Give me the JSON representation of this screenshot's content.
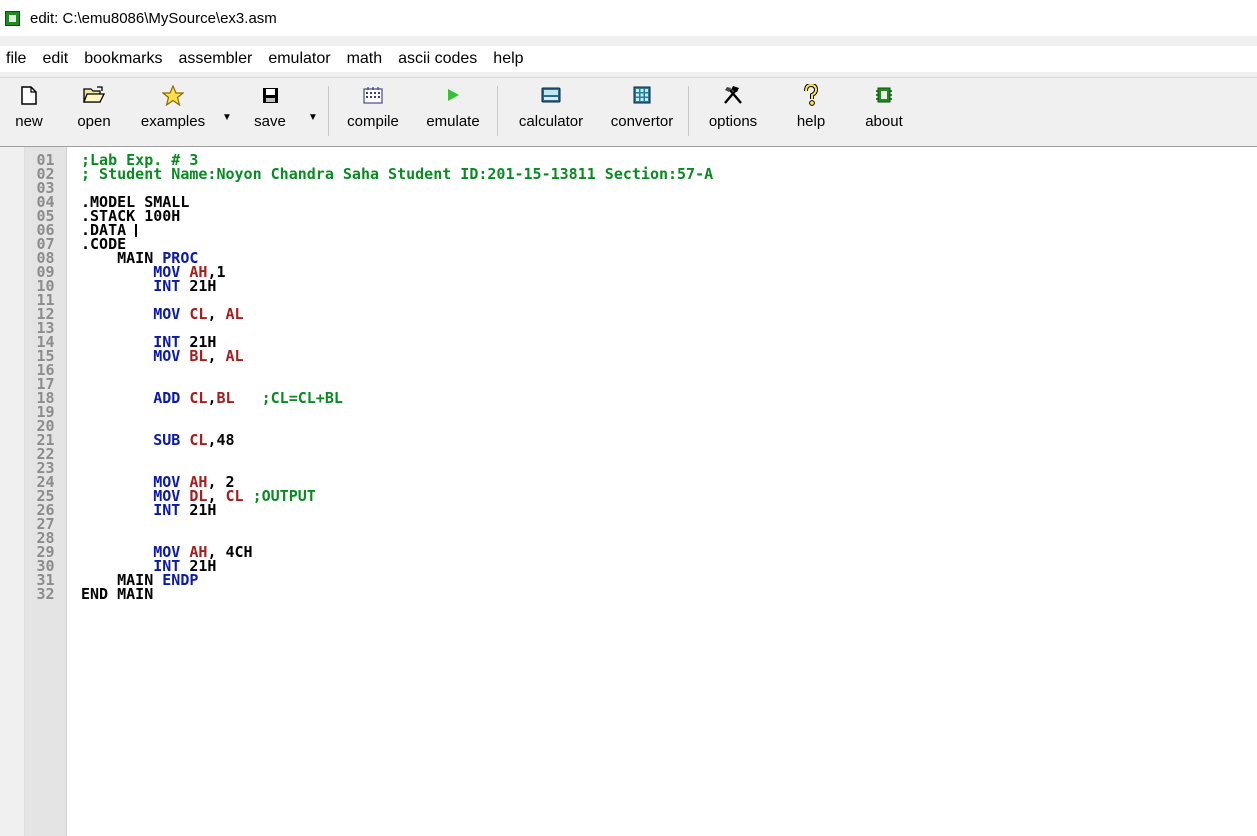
{
  "window": {
    "title": "edit: C:\\emu8086\\MySource\\ex3.asm",
    "icon": "chip-icon"
  },
  "menu": [
    "file",
    "edit",
    "bookmarks",
    "assembler",
    "emulator",
    "math",
    "ascii codes",
    "help"
  ],
  "toolbar": {
    "new": "new",
    "open": "open",
    "examples": "examples",
    "save": "save",
    "compile": "compile",
    "emulate": "emulate",
    "calculator": "calculator",
    "convertor": "convertor",
    "options": "options",
    "help": "help",
    "about": "about"
  },
  "colors": {
    "comment": "#0a8a23",
    "keyword": "#0b1aa8",
    "register": "#a31e1e"
  },
  "editor": {
    "line_numbers": [
      "01",
      "02",
      "03",
      "04",
      "05",
      "06",
      "07",
      "08",
      "09",
      "10",
      "11",
      "12",
      "13",
      "14",
      "15",
      "16",
      "17",
      "18",
      "19",
      "20",
      "21",
      "22",
      "23",
      "24",
      "25",
      "26",
      "27",
      "28",
      "29",
      "30",
      "31",
      "32"
    ],
    "lines": [
      [
        {
          "t": "comment",
          "v": ";Lab Exp. # 3"
        }
      ],
      [
        {
          "t": "comment",
          "v": "; Student Name:Noyon Chandra Saha Student ID:201-15-13811 Section:57-A"
        }
      ],
      [],
      [
        {
          "t": "plain",
          "v": ".MODEL SMALL"
        }
      ],
      [
        {
          "t": "plain",
          "v": ".STACK 100H"
        }
      ],
      [
        {
          "t": "plain",
          "v": ".DATA "
        },
        {
          "t": "cursor",
          "v": ""
        }
      ],
      [
        {
          "t": "plain",
          "v": ".CODE"
        }
      ],
      [
        {
          "t": "plain",
          "v": "    MAIN "
        },
        {
          "t": "keyword",
          "v": "PROC"
        }
      ],
      [
        {
          "t": "plain",
          "v": "        "
        },
        {
          "t": "keyword",
          "v": "MOV "
        },
        {
          "t": "register",
          "v": "AH"
        },
        {
          "t": "plain",
          "v": ",1"
        }
      ],
      [
        {
          "t": "plain",
          "v": "        "
        },
        {
          "t": "keyword",
          "v": "INT "
        },
        {
          "t": "plain",
          "v": "21H"
        }
      ],
      [],
      [
        {
          "t": "plain",
          "v": "        "
        },
        {
          "t": "keyword",
          "v": "MOV "
        },
        {
          "t": "register",
          "v": "CL"
        },
        {
          "t": "plain",
          "v": ", "
        },
        {
          "t": "register",
          "v": "AL"
        }
      ],
      [],
      [
        {
          "t": "plain",
          "v": "        "
        },
        {
          "t": "keyword",
          "v": "INT "
        },
        {
          "t": "plain",
          "v": "21H"
        }
      ],
      [
        {
          "t": "plain",
          "v": "        "
        },
        {
          "t": "keyword",
          "v": "MOV "
        },
        {
          "t": "register",
          "v": "BL"
        },
        {
          "t": "plain",
          "v": ", "
        },
        {
          "t": "register",
          "v": "AL"
        }
      ],
      [],
      [],
      [
        {
          "t": "plain",
          "v": "        "
        },
        {
          "t": "keyword",
          "v": "ADD "
        },
        {
          "t": "register",
          "v": "CL"
        },
        {
          "t": "plain",
          "v": ","
        },
        {
          "t": "register",
          "v": "BL"
        },
        {
          "t": "plain",
          "v": "   "
        },
        {
          "t": "comment",
          "v": ";CL=CL+BL"
        }
      ],
      [],
      [],
      [
        {
          "t": "plain",
          "v": "        "
        },
        {
          "t": "keyword",
          "v": "SUB "
        },
        {
          "t": "register",
          "v": "CL"
        },
        {
          "t": "plain",
          "v": ",48"
        }
      ],
      [],
      [],
      [
        {
          "t": "plain",
          "v": "        "
        },
        {
          "t": "keyword",
          "v": "MOV "
        },
        {
          "t": "register",
          "v": "AH"
        },
        {
          "t": "plain",
          "v": ", 2"
        }
      ],
      [
        {
          "t": "plain",
          "v": "        "
        },
        {
          "t": "keyword",
          "v": "MOV "
        },
        {
          "t": "register",
          "v": "DL"
        },
        {
          "t": "plain",
          "v": ", "
        },
        {
          "t": "register",
          "v": "CL"
        },
        {
          "t": "plain",
          "v": " "
        },
        {
          "t": "comment",
          "v": ";OUTPUT"
        }
      ],
      [
        {
          "t": "plain",
          "v": "        "
        },
        {
          "t": "keyword",
          "v": "INT "
        },
        {
          "t": "plain",
          "v": "21H"
        }
      ],
      [],
      [],
      [
        {
          "t": "plain",
          "v": "        "
        },
        {
          "t": "keyword",
          "v": "MOV "
        },
        {
          "t": "register",
          "v": "AH"
        },
        {
          "t": "plain",
          "v": ", 4CH"
        }
      ],
      [
        {
          "t": "plain",
          "v": "        "
        },
        {
          "t": "keyword",
          "v": "INT "
        },
        {
          "t": "plain",
          "v": "21H"
        }
      ],
      [
        {
          "t": "plain",
          "v": "    MAIN "
        },
        {
          "t": "keyword",
          "v": "ENDP"
        }
      ],
      [
        {
          "t": "plain",
          "v": "END MAIN"
        }
      ]
    ]
  }
}
